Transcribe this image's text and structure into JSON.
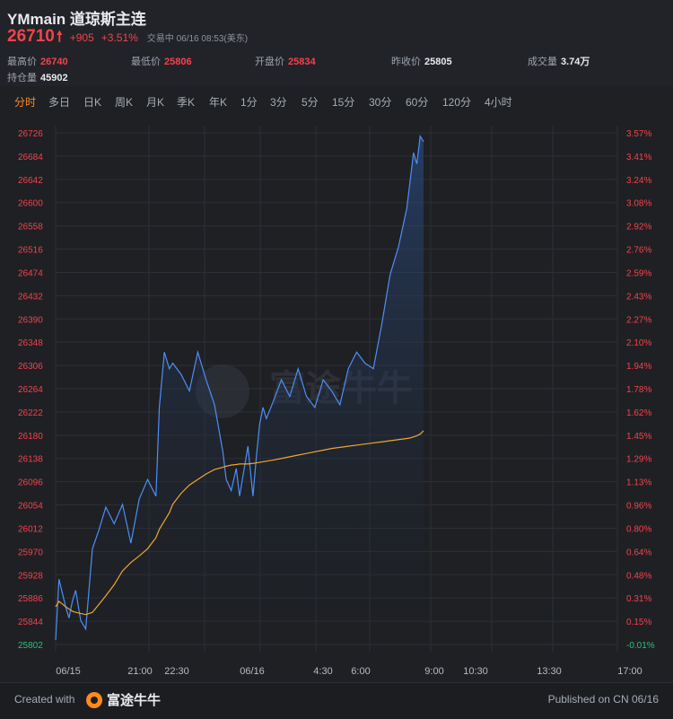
{
  "header": {
    "title": "YMmain 道琼斯主连",
    "last_price": "26710",
    "change": "+905",
    "change_pct": "+3.51%",
    "status": "交易中 06/16 08:53(美东)",
    "stats": [
      {
        "label": "最高价",
        "value": "26740",
        "color": "red"
      },
      {
        "label": "最低价",
        "value": "25806",
        "color": "red"
      },
      {
        "label": "开盘价",
        "value": "25834",
        "color": "red"
      },
      {
        "label": "昨收价",
        "value": "25805",
        "color": "white"
      },
      {
        "label": "成交量",
        "value": "3.74万",
        "color": "white"
      },
      {
        "label": "持仓量",
        "value": "45902",
        "color": "white"
      }
    ]
  },
  "periods": [
    "分时",
    "多日",
    "日K",
    "周K",
    "月K",
    "季K",
    "年K",
    "1分",
    "3分",
    "5分",
    "15分",
    "30分",
    "60分",
    "120分",
    "4小时"
  ],
  "active_period": "分时",
  "colors": {
    "up": "#f5424c",
    "line": "#4d8ff7",
    "avg": "#f0a630",
    "active": "#ff8a1a",
    "neutral": "#2ac27a"
  },
  "watermark": "富途牛牛",
  "chart_data": {
    "type": "line",
    "title": "",
    "ylim": [
      25802,
      26726
    ],
    "y_ticks": [
      "26726",
      "26684",
      "26642",
      "26600",
      "26558",
      "26516",
      "26474",
      "26432",
      "26390",
      "26348",
      "26306",
      "26264",
      "26222",
      "26180",
      "26138",
      "26096",
      "26054",
      "26012",
      "25970",
      "25928",
      "25886",
      "25844",
      "25802"
    ],
    "y2_ticks": [
      "3.57%",
      "3.41%",
      "3.24%",
      "3.08%",
      "2.92%",
      "2.76%",
      "2.59%",
      "2.43%",
      "2.27%",
      "2.10%",
      "1.94%",
      "1.78%",
      "1.62%",
      "1.45%",
      "1.29%",
      "1.13%",
      "0.96%",
      "0.80%",
      "0.64%",
      "0.48%",
      "0.31%",
      "0.15%",
      "-0.01%"
    ],
    "x_ticks": [
      "06/15",
      "21:00",
      "22:30",
      "06/16",
      "4:30",
      "6:00",
      "9:00",
      "10:30",
      "13:30",
      "17:00"
    ],
    "x": [
      0,
      2,
      4,
      6,
      8,
      10,
      12,
      15,
      18,
      22,
      26,
      30,
      35,
      40,
      45,
      50,
      55,
      60,
      62,
      65,
      68,
      70,
      75,
      80,
      85,
      90,
      95,
      100,
      102,
      105,
      108,
      110,
      115,
      118,
      120,
      122,
      124,
      126,
      130,
      135,
      140,
      145,
      150,
      155,
      160,
      165,
      170,
      175,
      180,
      185,
      190,
      195,
      200,
      205,
      210,
      212,
      214,
      216,
      218,
      220
    ],
    "series": [
      {
        "values": [
          25810,
          25920,
          25895,
          25870,
          25850,
          25880,
          25900,
          25845,
          25830,
          25975,
          26010,
          26050,
          26020,
          26055,
          25985,
          26065,
          26100,
          26070,
          26230,
          26330,
          26300,
          26310,
          26290,
          26260,
          26330,
          26280,
          26235,
          26150,
          26100,
          26080,
          26120,
          26070,
          26160,
          26070,
          26140,
          26200,
          26230,
          26210,
          26240,
          26280,
          26250,
          26300,
          26250,
          26230,
          26280,
          26260,
          26235,
          26300,
          26330,
          26310,
          26300,
          26380,
          26470,
          26520,
          26590,
          26640,
          26690,
          26670,
          26720,
          26710
        ],
        "mark_label": ""
      },
      {
        "values": [
          25870,
          25880,
          25875,
          25870,
          25866,
          25862,
          25860,
          25858,
          25856,
          25860,
          25875,
          25890,
          25910,
          25935,
          25950,
          25962,
          25975,
          25995,
          26010,
          26025,
          26040,
          26055,
          26075,
          26090,
          26100,
          26110,
          26118,
          26122,
          26124,
          26126,
          26127,
          26128,
          26128,
          26129,
          26130,
          26131,
          26132,
          26133,
          26135,
          26138,
          26141,
          26144,
          26147,
          26150,
          26153,
          26156,
          26158,
          26160,
          26162,
          26164,
          26166,
          26168,
          26170,
          26172,
          26174,
          26175,
          26177,
          26179,
          26182,
          26188
        ],
        "mark_label": ""
      }
    ]
  },
  "footer": {
    "created_with": "Created with",
    "brand": "富途牛牛",
    "published": "Published on CN 06/16"
  }
}
